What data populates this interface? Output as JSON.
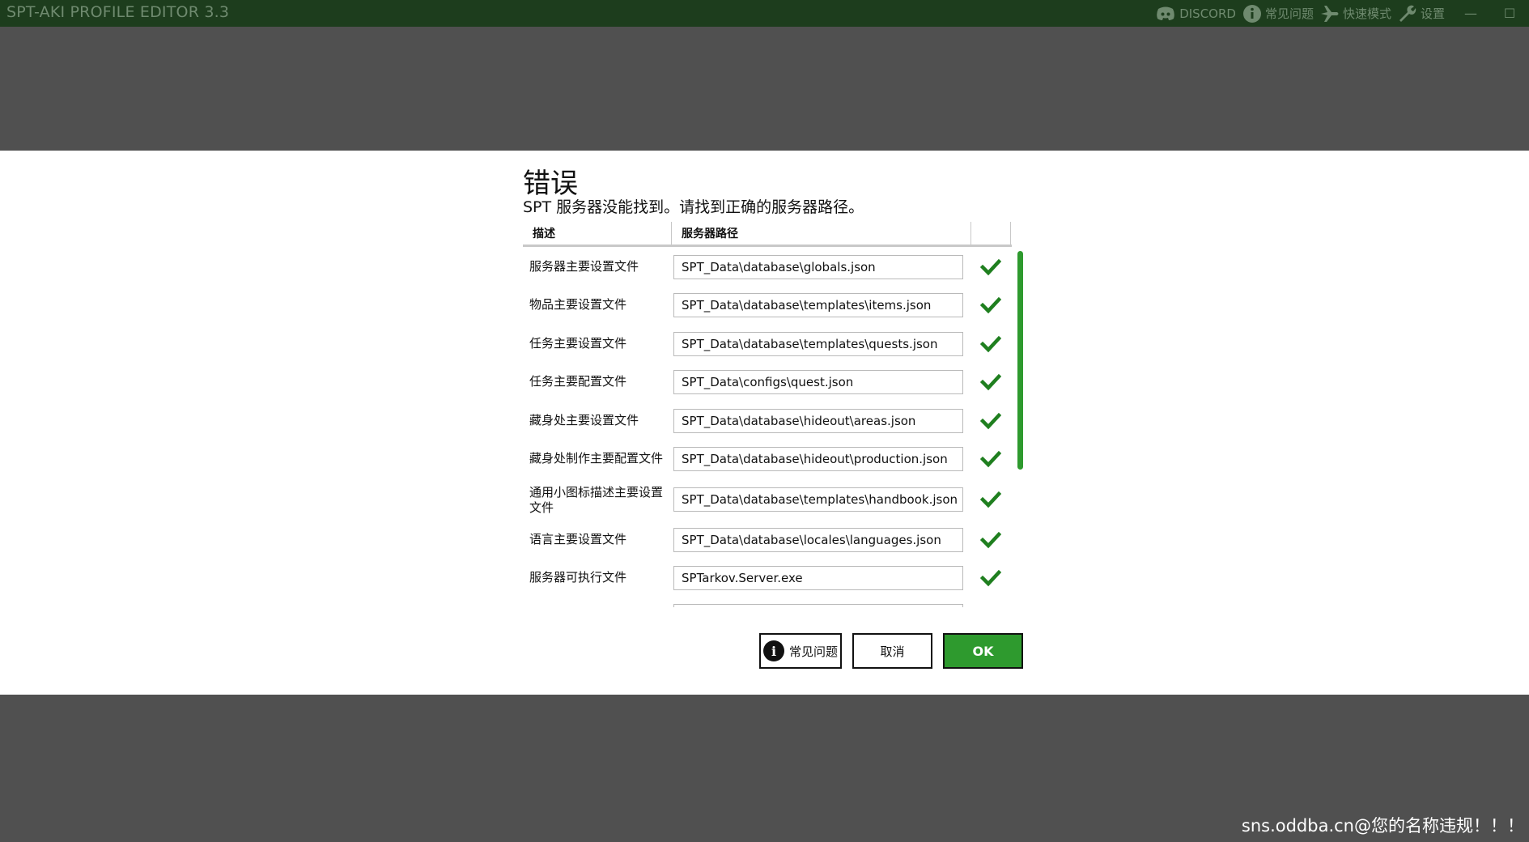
{
  "titlebar": {
    "app_title": "SPT-AKI PROFILE EDITOR  3.3",
    "discord_label": "DISCORD",
    "faq_label": "常见问题",
    "fast_mode_label": "快速模式",
    "settings_label": "设置",
    "minimize_glyph": "—",
    "maximize_glyph": "☐"
  },
  "dialog": {
    "title": "错误",
    "message": "SPT 服务器没能找到。请找到正确的服务器路径。",
    "columns": {
      "description": "描述",
      "server_path": "服务器路径"
    },
    "rows": [
      {
        "label": "服务器主要设置文件",
        "path": "SPT_Data\\database\\globals.json",
        "status": "ok"
      },
      {
        "label": "物品主要设置文件",
        "path": "SPT_Data\\database\\templates\\items.json",
        "status": "ok"
      },
      {
        "label": "任务主要设置文件",
        "path": "SPT_Data\\database\\templates\\quests.json",
        "status": "ok"
      },
      {
        "label": "任务主要配置文件",
        "path": "SPT_Data\\configs\\quest.json",
        "status": "ok"
      },
      {
        "label": "藏身处主要设置文件",
        "path": "SPT_Data\\database\\hideout\\areas.json",
        "status": "ok"
      },
      {
        "label": "藏身处制作主要配置文件",
        "path": "SPT_Data\\database\\hideout\\production.json",
        "status": "ok"
      },
      {
        "label": "通用小图标描述主要设置文件",
        "path": "SPT_Data\\database\\templates\\handbook.json",
        "status": "ok"
      },
      {
        "label": "语言主要设置文件",
        "path": "SPT_Data\\database\\locales\\languages.json",
        "status": "ok"
      },
      {
        "label": "服务器可执行文件",
        "path": "SPTarkov.Server.exe",
        "status": "ok"
      }
    ],
    "buttons": {
      "faq": "常见问题",
      "cancel": "取消",
      "ok": "OK"
    }
  },
  "watermark": "sns.oddba.cn@您的名称违规！！！",
  "colors": {
    "accent": "#2e9a2e",
    "titlebar": "#1d3d1d",
    "check": "#1f7f1f",
    "overlay": "#505050"
  }
}
